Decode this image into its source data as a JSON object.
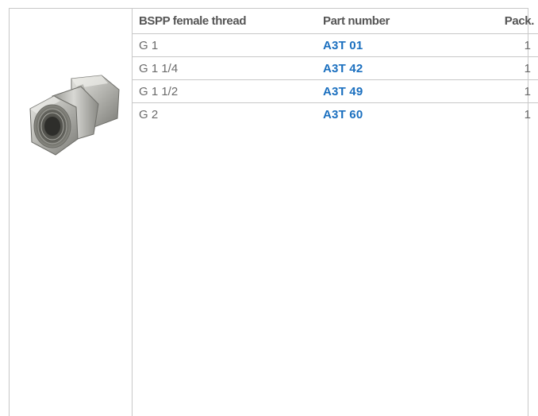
{
  "table": {
    "headers": {
      "thread": "BSPP female thread",
      "part_number": "Part number",
      "pack": "Pack."
    },
    "rows": [
      {
        "thread": "G 1",
        "part_number": "A3T 01",
        "pack": "1"
      },
      {
        "thread": "G 1 1/4",
        "part_number": "A3T 42",
        "pack": "1"
      },
      {
        "thread": "G 1 1/2",
        "part_number": "A3T 49",
        "pack": "1"
      },
      {
        "thread": "G 2",
        "part_number": "A3T 60",
        "pack": "1"
      }
    ]
  },
  "colors": {
    "part_number": "#1a6fbf",
    "text": "#555555",
    "rule": "#c8c8c8"
  },
  "image": {
    "icon": "pipe-union-fitting-icon"
  }
}
